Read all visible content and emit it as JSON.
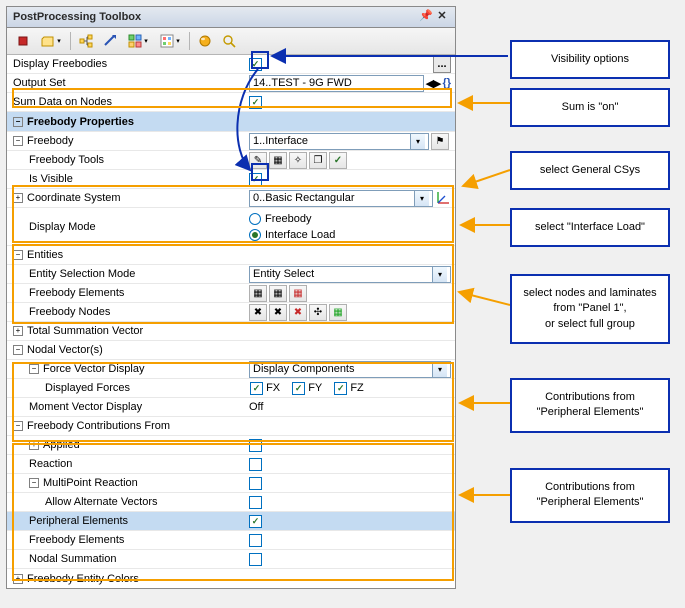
{
  "window": {
    "title": "PostProcessing Toolbox",
    "pin": "📌",
    "close": "✕"
  },
  "rows": {
    "display_freebodies": "Display Freebodies",
    "output_set": {
      "label": "Output Set",
      "value": "14..TEST - 9G FWD"
    },
    "sum_data": "Sum Data on Nodes",
    "section_props": "Freebody Properties",
    "freebody": {
      "label": "Freebody",
      "value": "1..Interface"
    },
    "tools": "Freebody Tools",
    "is_visible": "Is Visible",
    "csys": {
      "label": "Coordinate System",
      "value": "0..Basic Rectangular"
    },
    "display_mode": {
      "label": "Display Mode",
      "opt1": "Freebody",
      "opt2": "Interface Load"
    },
    "entities": "Entities",
    "sel_mode": {
      "label": "Entity Selection Mode",
      "value": "Entity Select"
    },
    "elems": "Freebody Elements",
    "nodes": "Freebody Nodes",
    "total_sum": "Total Summation Vector",
    "nodal_vec": "Nodal Vector(s)",
    "fvd": {
      "label": "Force Vector Display",
      "value": "Display Components"
    },
    "disp_forces": {
      "label": "Displayed Forces",
      "fx": "FX",
      "fy": "FY",
      "fz": "FZ"
    },
    "mvd": {
      "label": "Moment Vector Display",
      "value": "Off"
    },
    "contrib": "Freebody Contributions From",
    "applied": "Applied",
    "reaction": "Reaction",
    "multipoint": "MultiPoint Reaction",
    "allow_alt": "Allow Alternate Vectors",
    "periph": "Peripheral Elements",
    "fb_elems": "Freebody Elements",
    "nodal_sum": "Nodal Summation",
    "entity_colors": "Freebody Entity Colors"
  },
  "callouts": {
    "vis": "Visibility options",
    "sum": "Sum is \"on\"",
    "csys": "select General CSys",
    "iload": "select \"Interface Load\"",
    "entities": "select nodes and laminates from \"Panel 1\",\nor select full group",
    "contrib1": "Contributions from \"Peripheral Elements\"",
    "contrib2": "Contributions from \"Peripheral Elements\""
  }
}
